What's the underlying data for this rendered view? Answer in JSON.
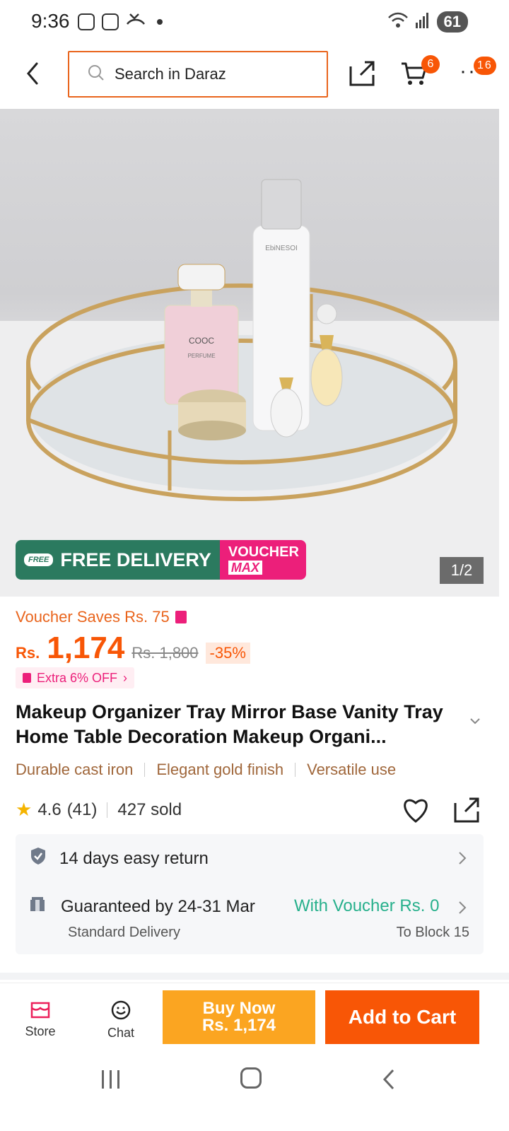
{
  "status_bar": {
    "time": "9:36",
    "battery": "61"
  },
  "header": {
    "search_placeholder": "Search in Daraz",
    "cart_count": "6",
    "more_count": "16"
  },
  "hero": {
    "promo_free": "FREE DELIVERY",
    "promo_free_tag": "FREE",
    "promo_voucher_line1": "VOUCHER",
    "promo_voucher_line2": "MAX",
    "pager": "1/2",
    "product_labels": {
      "perfume_brand": "COOC",
      "perfume_type": "PERFUME",
      "bottle_brand": "EbiNESOI"
    }
  },
  "product": {
    "voucher_saves": "Voucher Saves Rs. 75",
    "currency": "Rs.",
    "price": "1,174",
    "old_price": "Rs. 1,800",
    "discount": "-35%",
    "extra_off": "Extra 6% OFF",
    "title": "Makeup Organizer Tray Mirror Base Vanity Tray Home Table Decoration Makeup Organi...",
    "features": [
      "Durable cast iron",
      "Elegant gold finish",
      "Versatile use"
    ],
    "rating": "4.6",
    "reviews": "(41)",
    "sold": "427 sold"
  },
  "delivery": {
    "returns": "14 days easy return",
    "guarantee": "Guaranteed by 24-31 Mar",
    "voucher_info": "With Voucher Rs. 0",
    "method": "Standard Delivery",
    "location": "To Block 15"
  },
  "actions": {
    "store": "Store",
    "chat": "Chat",
    "buy_now_line1": "Buy Now",
    "buy_now_line2": "Rs. 1,174",
    "add_to_cart": "Add to Cart"
  },
  "colors": {
    "brand_orange": "#f85606",
    "buy_now": "#fba521",
    "free_delivery_green": "#2b7a5f",
    "voucher_pink": "#ec1f7a",
    "voucher_green_text": "#27b08c"
  }
}
